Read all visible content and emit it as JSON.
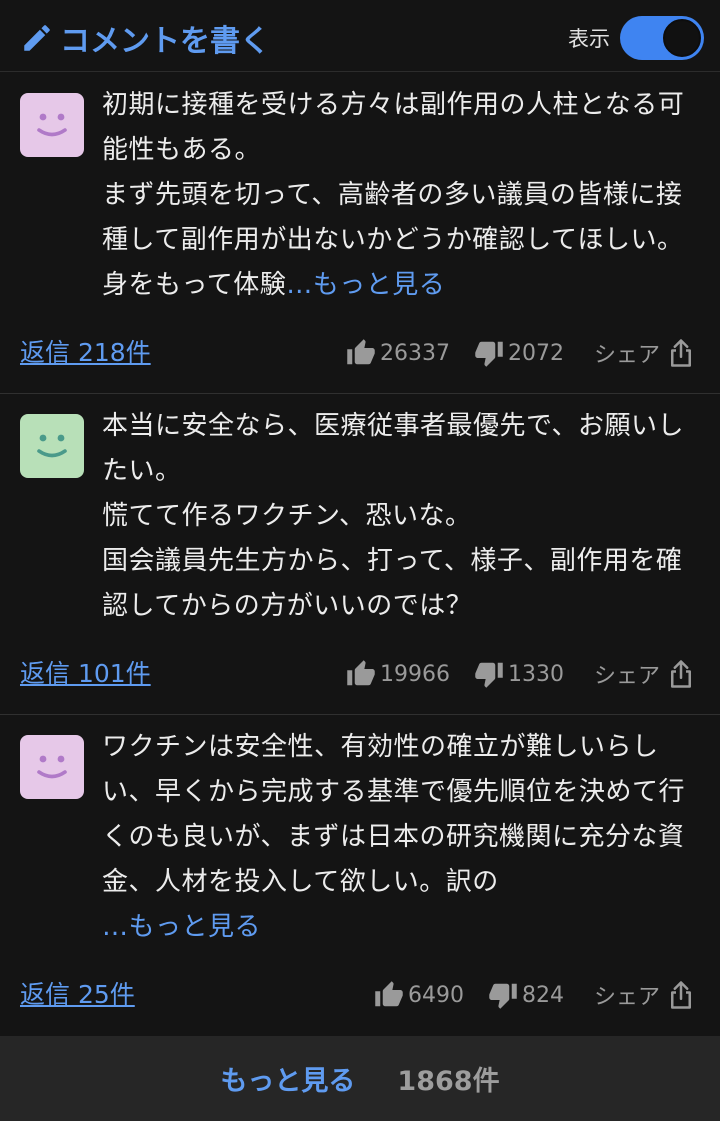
{
  "header": {
    "write_label": "コメントを書く",
    "display_label": "表示",
    "display_on": true,
    "accent": "#5f9bf0"
  },
  "comments": [
    {
      "avatar_color": "#e6c8e8",
      "avatar_face": "#b07ac8",
      "text": "初期に接種を受ける方々は副作用の人柱となる可能性もある。\nまず先頭を切って、高齢者の多い議員の皆様に接種して副作用が出ないかどうか確認してほしい。身をもって体験",
      "more": "…もっと見る",
      "reply": "返信 218件",
      "likes": "26337",
      "dislikes": "2072",
      "share": "シェア"
    },
    {
      "avatar_color": "#b8e0b8",
      "avatar_face": "#4a9a8a",
      "text": "本当に安全なら、医療従事者最優先で、お願いしたい。\n慌てて作るワクチン、恐いな。\n国会議員先生方から、打って、様子、副作用を確認してからの方がいいのでは？",
      "more": "",
      "reply": "返信 101件",
      "likes": "19966",
      "dislikes": "1330",
      "share": "シェア"
    },
    {
      "avatar_color": "#e6c8e8",
      "avatar_face": "#b07ac8",
      "text": "ワクチンは安全性、有効性の確立が難しいらしい、早くから完成する基準で優先順位を決めて行くのも良いが、まずは日本の研究機関に充分な資金、人材を投入して欲しい。訳の",
      "more": "…もっと見る",
      "reply": "返信 25件",
      "likes": "6490",
      "dislikes": "824",
      "share": "シェア"
    }
  ],
  "footer": {
    "more_label": "もっと見る",
    "total_count": "1868件"
  }
}
